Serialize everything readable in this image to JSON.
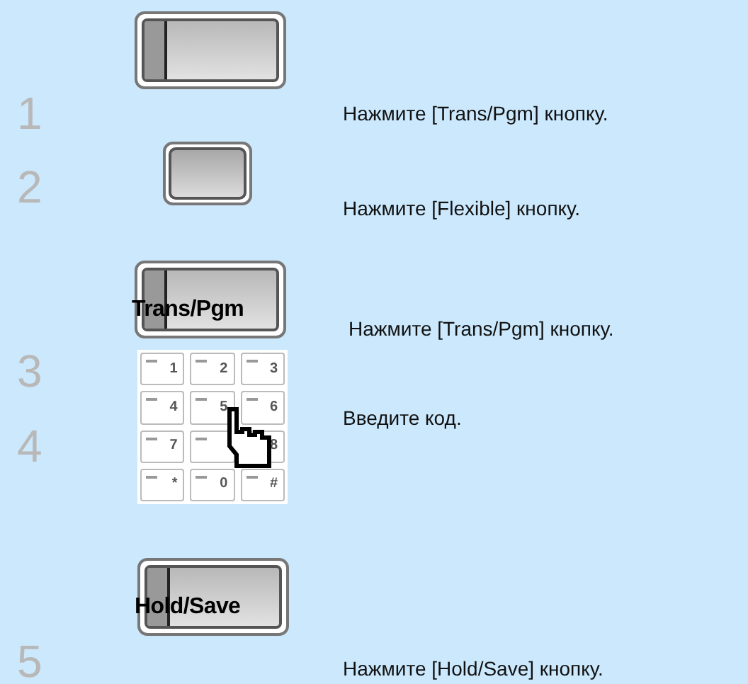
{
  "steps": [
    {
      "number": "1",
      "text": "Нажмите [Trans/Pgm] кнопку."
    },
    {
      "number": "2",
      "text": "Нажмите [Flexible] кнопку."
    },
    {
      "number": "3",
      "text": "Нажмите [Trans/Pgm] кнопку."
    },
    {
      "number": "4",
      "text": "Введите код."
    },
    {
      "number": "5",
      "text": "Нажмите [Hold/Save] кнопку."
    }
  ],
  "images": [
    {
      "kind": "striped_key"
    },
    {
      "kind": "plain_key"
    },
    {
      "kind": "striped_key",
      "label": "Trans/Pgm"
    },
    {
      "kind": "keypad",
      "keys": [
        "1",
        "2",
        "3",
        "4",
        "5",
        "6",
        "7",
        "8",
        "*",
        "0",
        "#"
      ]
    },
    {
      "kind": "striped_key",
      "label": "Hold/Save"
    }
  ]
}
